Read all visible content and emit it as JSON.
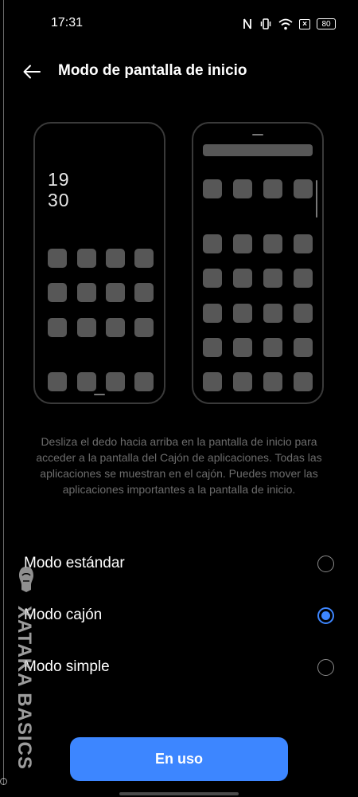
{
  "status_bar": {
    "time": "17:31",
    "battery": "80",
    "icons": [
      "nfc-icon",
      "vibrate-icon",
      "wifi-icon",
      "no-sim-icon",
      "battery-icon"
    ]
  },
  "header": {
    "title": "Modo de pantalla de inicio",
    "back_icon": "arrow-left-icon"
  },
  "preview": {
    "standard_clock_hour": "19",
    "standard_clock_minute": "30"
  },
  "description": "Desliza el dedo hacia arriba en la pantalla de inicio para acceder a la pantalla del Cajón de aplicaciones. Todas las aplicaciones se muestran en el cajón. Puedes mover las aplicaciones importantes a la pantalla de inicio.",
  "options": [
    {
      "label": "Modo estándar",
      "selected": false
    },
    {
      "label": "Modo cajón",
      "selected": true
    },
    {
      "label": "Modo simple",
      "selected": false
    }
  ],
  "watermark": "XATAKA BASICS",
  "cta_label": "En uso",
  "colors": {
    "accent": "#3d86ff",
    "background": "#000000",
    "placeholder_icon": "#575757",
    "description_text": "#6c6c6c"
  }
}
